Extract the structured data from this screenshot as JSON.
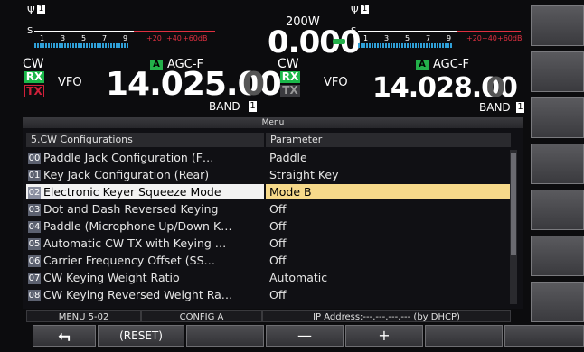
{
  "left": {
    "mode": "CW",
    "rx": "RX",
    "tx": "TX",
    "vfo": "VFO",
    "ant_num": "1",
    "a_badge": "A",
    "agc": "AGC-F",
    "freq_main": "14.025.00",
    "freq_last": "0",
    "band": "BAND",
    "band_num": "1",
    "scale_s": "S",
    "scale_nums": [
      "1",
      "3",
      "5",
      "7",
      "9"
    ],
    "scale_plus": [
      "+20",
      "+40",
      "+60dB"
    ]
  },
  "center": {
    "power": "200W",
    "power_value": "0.000"
  },
  "right": {
    "mode": "CW",
    "rx": "RX",
    "tx": "TX",
    "vfo": "VFO",
    "ant_num": "1",
    "a_badge": "A",
    "agc": "AGC-F",
    "freq_main": "14.028.00",
    "freq_last": "0",
    "band": "BAND",
    "band_num": "1",
    "scale_s": "S",
    "scale_nums": [
      "1",
      "3",
      "5",
      "7",
      "9"
    ],
    "scale_plus": [
      "+20",
      "+40",
      "+60dB"
    ]
  },
  "menu": {
    "title": "Menu",
    "header_item": "5.CW Configurations",
    "header_param": "Parameter",
    "rows": [
      {
        "num": "00",
        "item": "Paddle Jack Configuration (F…",
        "param": "Paddle"
      },
      {
        "num": "01",
        "item": "Key Jack Configuration (Rear)",
        "param": "Straight Key"
      },
      {
        "num": "02",
        "item": "Electronic Keyer Squeeze Mode",
        "param": "Mode B"
      },
      {
        "num": "03",
        "item": "Dot and Dash Reversed Keying",
        "param": "Off"
      },
      {
        "num": "04",
        "item": "Paddle (Microphone Up/Down K…",
        "param": "Off"
      },
      {
        "num": "05",
        "item": "Automatic CW TX with Keying …",
        "param": "Off"
      },
      {
        "num": "06",
        "item": "Carrier Frequency Offset (SS…",
        "param": "Off"
      },
      {
        "num": "07",
        "item": "CW Keying Weight Ratio",
        "param": "Automatic"
      },
      {
        "num": "08",
        "item": "CW Keying Reversed Weight Ra…",
        "param": "Off"
      }
    ],
    "selected_index": 2
  },
  "status": {
    "menu_no": "MENU 5-02",
    "config": "CONFIG A",
    "ip": "IP Address:---.---.---.--- (by DHCP)"
  },
  "softkeys": {
    "back_icon": "return-arrow-icon",
    "reset": "(RESET)",
    "minus": "—",
    "plus": "+"
  },
  "colors": {
    "rx_green": "#1bb84a",
    "tx_red": "#d0203a",
    "a_green": "#23b04a",
    "scale_cyan": "#2fa0d8",
    "selected_param": "#f6d98a"
  }
}
